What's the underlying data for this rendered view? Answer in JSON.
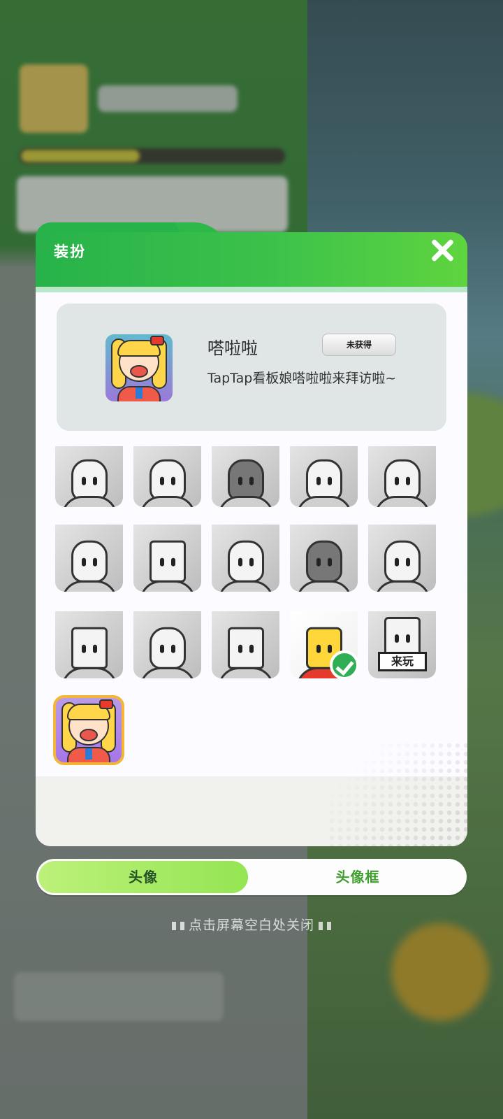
{
  "dialog": {
    "title": "装扮",
    "close_icon": "close-icon"
  },
  "selected_item": {
    "name": "嗒啦啦",
    "status": "未获得",
    "description": "TapTap看板娘嗒啦啦来拜访啦~"
  },
  "avatar_grid": {
    "locked_count": 14,
    "owned_item_sign": "来玩",
    "equipped_icon": "check-icon"
  },
  "tabs": {
    "avatar_label": "头像",
    "frame_label": "头像框"
  },
  "hint": {
    "close_text": "点击屏幕空白处关闭"
  },
  "colors": {
    "header_green": "#27b24a",
    "active_tab": "#a6ec63",
    "selected_border": "#f3b636",
    "check_green": "#2fae55"
  }
}
